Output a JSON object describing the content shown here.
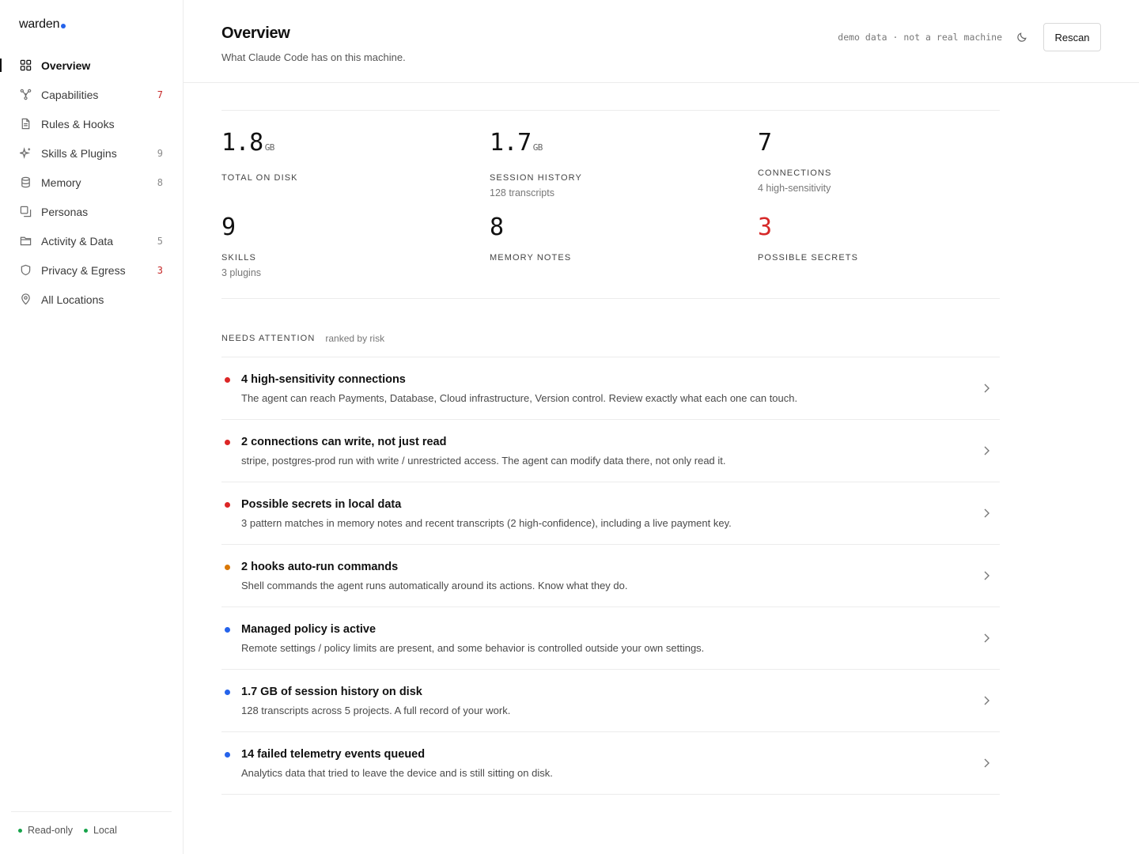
{
  "brand": {
    "name": "warden",
    "dot_color": "#2563eb"
  },
  "sidebar": {
    "items": [
      {
        "label": "Overview",
        "count": "",
        "icon": "grid-icon",
        "active": true
      },
      {
        "label": "Capabilities",
        "count": "7",
        "icon": "nodes-icon",
        "alert": true
      },
      {
        "label": "Rules & Hooks",
        "count": "",
        "icon": "document-icon"
      },
      {
        "label": "Skills & Plugins",
        "count": "9",
        "icon": "sparkle-icon"
      },
      {
        "label": "Memory",
        "count": "8",
        "icon": "database-icon"
      },
      {
        "label": "Personas",
        "count": "",
        "icon": "cards-icon"
      },
      {
        "label": "Activity & Data",
        "count": "5",
        "icon": "folder-icon"
      },
      {
        "label": "Privacy & Egress",
        "count": "3",
        "icon": "shield-icon",
        "alert": true
      },
      {
        "label": "All Locations",
        "count": "",
        "icon": "pin-icon"
      }
    ],
    "footer": {
      "readonly": "Read-only",
      "local": "Local",
      "status_color": "#16a34a"
    }
  },
  "header": {
    "title": "Overview",
    "subtitle": "What Claude Code has on this machine.",
    "demo_note": "demo data · not a real machine",
    "theme_icon": "moon-icon",
    "rescan_label": "Rescan"
  },
  "stats": [
    {
      "value": "1.8",
      "unit": "GB",
      "label": "TOTAL ON DISK",
      "sub": ""
    },
    {
      "value": "1.7",
      "unit": "GB",
      "label": "SESSION HISTORY",
      "sub": "128 transcripts"
    },
    {
      "value": "7",
      "unit": "",
      "label": "CONNECTIONS",
      "sub": "4 high-sensitivity"
    },
    {
      "value": "9",
      "unit": "",
      "label": "SKILLS",
      "sub": "3 plugins"
    },
    {
      "value": "8",
      "unit": "",
      "label": "MEMORY NOTES",
      "sub": ""
    },
    {
      "value": "3",
      "unit": "",
      "label": "POSSIBLE SECRETS",
      "sub": "",
      "alert": true
    }
  ],
  "attention": {
    "title": "NEEDS ATTENTION",
    "subtitle": "ranked by risk",
    "severity_colors": {
      "high": "#dc2626",
      "medium": "#d97706",
      "info": "#2563eb"
    },
    "items": [
      {
        "severity": "high",
        "title": "4 high-sensitivity connections",
        "desc": "The agent can reach Payments, Database, Cloud infrastructure, Version control. Review exactly what each one can touch."
      },
      {
        "severity": "high",
        "title": "2 connections can write, not just read",
        "desc": "stripe, postgres-prod run with write / unrestricted access. The agent can modify data there, not only read it."
      },
      {
        "severity": "high",
        "title": "Possible secrets in local data",
        "desc": "3 pattern matches in memory notes and recent transcripts (2 high-confidence), including a live payment key."
      },
      {
        "severity": "medium",
        "title": "2 hooks auto-run commands",
        "desc": "Shell commands the agent runs automatically around its actions. Know what they do."
      },
      {
        "severity": "info",
        "title": "Managed policy is active",
        "desc": "Remote settings / policy limits are present, and some behavior is controlled outside your own settings."
      },
      {
        "severity": "info",
        "title": "1.7 GB of session history on disk",
        "desc": "128 transcripts across 5 projects. A full record of your work."
      },
      {
        "severity": "info",
        "title": "14 failed telemetry events queued",
        "desc": "Analytics data that tried to leave the device and is still sitting on disk."
      }
    ]
  }
}
